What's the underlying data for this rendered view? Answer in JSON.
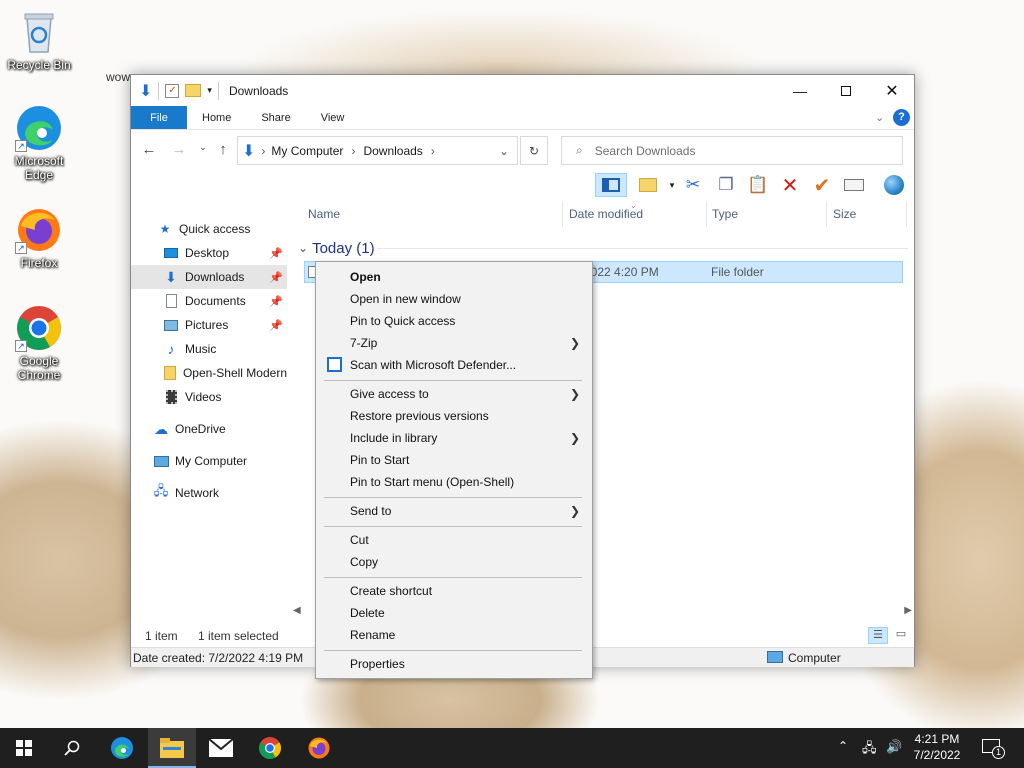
{
  "desktop": {
    "icons": [
      {
        "label": "Recycle Bin"
      },
      {
        "label": "Microsoft Edge"
      },
      {
        "label": "Firefox"
      },
      {
        "label": "Google Chrome"
      }
    ],
    "stray_text": "wow"
  },
  "explorer": {
    "title": "Downloads",
    "ribbon_tabs": [
      "File",
      "Home",
      "Share",
      "View"
    ],
    "breadcrumb": [
      "My Computer",
      "Downloads"
    ],
    "search_placeholder": "Search Downloads",
    "columns": [
      "Name",
      "Date modified",
      "Type",
      "Size"
    ],
    "group": "Today (1)",
    "file": {
      "date_modified": "2022 4:20 PM",
      "type": "File folder"
    },
    "nav": [
      {
        "label": "Quick access"
      },
      {
        "label": "Desktop"
      },
      {
        "label": "Downloads"
      },
      {
        "label": "Documents"
      },
      {
        "label": "Pictures"
      },
      {
        "label": "Music"
      },
      {
        "label": "Open-Shell Modern"
      },
      {
        "label": "Videos"
      },
      {
        "label": "OneDrive"
      },
      {
        "label": "My Computer"
      },
      {
        "label": "Network"
      }
    ],
    "status": {
      "item_count": "1 item",
      "selected": "1 item selected"
    },
    "details": {
      "date_created": "Date created: 7/2/2022 4:19 PM",
      "location": "Computer"
    }
  },
  "context_menu": {
    "items": [
      "Open",
      "Open in new window",
      "Pin to Quick access",
      "7-Zip",
      "Scan with Microsoft Defender...",
      "Give access to",
      "Restore previous versions",
      "Include in library",
      "Pin to Start",
      "Pin to Start menu (Open-Shell)",
      "Send to",
      "Cut",
      "Copy",
      "Create shortcut",
      "Delete",
      "Rename",
      "Properties"
    ]
  },
  "taskbar": {
    "time": "4:21 PM",
    "date": "7/2/2022",
    "notification_count": "1"
  },
  "colors": {
    "accent": "#1979ca",
    "selection": "#cce8ff",
    "taskbar": "#1f1f1f"
  }
}
